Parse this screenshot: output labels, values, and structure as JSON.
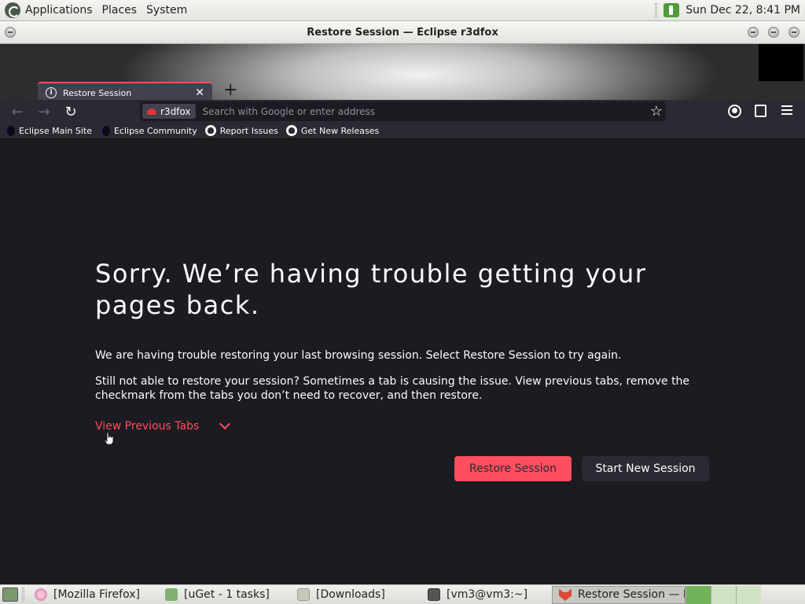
{
  "top_panel": {
    "menus": [
      "Applications",
      "Places",
      "System"
    ],
    "clock": "Sun Dec 22,  8:41 PM"
  },
  "window": {
    "title": "Restore Session — Eclipse r3dfox"
  },
  "tabs": [
    {
      "label": "Restore Session"
    }
  ],
  "urlbar": {
    "identity_label": "r3dfox",
    "placeholder": "Search with Google or enter address"
  },
  "bookmarks": [
    {
      "label": "Eclipse Main Site",
      "icon": "eclipse-icon"
    },
    {
      "label": "Eclipse Community",
      "icon": "eclipse-icon"
    },
    {
      "label": "Report Issues",
      "icon": "github-icon"
    },
    {
      "label": "Get New Releases",
      "icon": "github-icon"
    }
  ],
  "page": {
    "title": "Sorry. We’re having trouble getting your pages back.",
    "description_1": "We are having trouble restoring your last browsing session. Select Restore Session to try again.",
    "description_2": "Still not able to restore your session? Sometimes a tab is causing the issue. View previous tabs, remove the checkmark from the tabs you don’t need to recover, and then restore.",
    "view_tabs_label": "View Previous Tabs",
    "restore_button": "Restore Session",
    "new_session_button": "Start New Session"
  },
  "colors": {
    "accent": "#ff4f5e",
    "content_bg": "#1c1b22",
    "toolbar_bg": "#2b2a33"
  },
  "taskbar": {
    "tasks": [
      {
        "label": "[Mozilla Firefox]",
        "icon": "firefox-icon"
      },
      {
        "label": "[uGet - 1 tasks]",
        "icon": "uget-icon"
      },
      {
        "label": "[Downloads]",
        "icon": "folder-icon"
      },
      {
        "label": "[vm3@vm3:~]",
        "icon": "terminal-icon"
      },
      {
        "label": "Restore Session — E…",
        "icon": "r3dfox-icon"
      }
    ]
  }
}
